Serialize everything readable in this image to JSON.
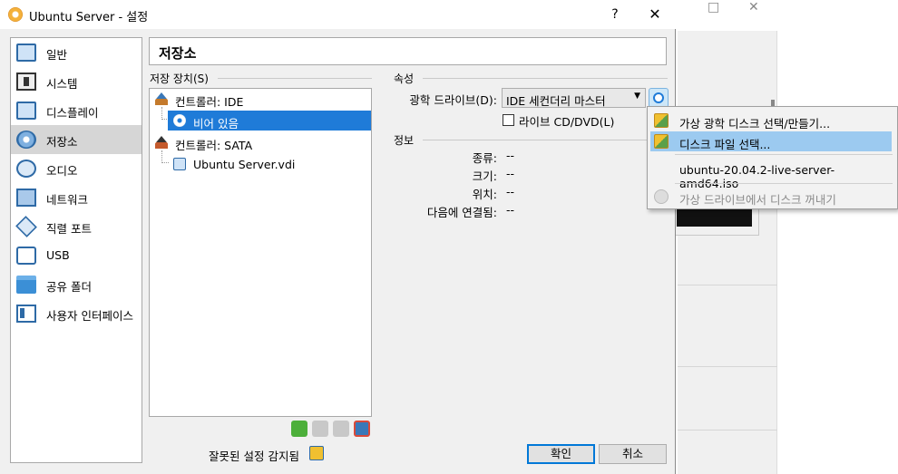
{
  "window": {
    "title": "Ubuntu Server - 설정",
    "help_label": "?",
    "close_label": "✕"
  },
  "sidebar": {
    "items": [
      {
        "label": "일반",
        "icon": "general-icon"
      },
      {
        "label": "시스템",
        "icon": "system-icon"
      },
      {
        "label": "디스플레이",
        "icon": "display-icon"
      },
      {
        "label": "저장소",
        "icon": "storage-icon",
        "selected": true
      },
      {
        "label": "오디오",
        "icon": "audio-icon"
      },
      {
        "label": "네트워크",
        "icon": "network-icon"
      },
      {
        "label": "직렬 포트",
        "icon": "serial-port-icon"
      },
      {
        "label": "USB",
        "icon": "usb-icon"
      },
      {
        "label": "공유 폴더",
        "icon": "shared-folder-icon"
      },
      {
        "label": "사용자 인터페이스",
        "icon": "user-interface-icon"
      }
    ]
  },
  "page": {
    "title": "저장소"
  },
  "storage_devices": {
    "label": "저장 장치(S)",
    "tree": [
      {
        "label": "컨트롤러: IDE",
        "type": "controller"
      },
      {
        "label": "비어 있음",
        "type": "optical",
        "selected": true
      },
      {
        "label": "컨트롤러: SATA",
        "type": "controller"
      },
      {
        "label": "Ubuntu Server.vdi",
        "type": "hard-disk"
      }
    ]
  },
  "attributes": {
    "label": "속성",
    "optical_drive_label": "광학 드라이브(D):",
    "optical_drive_value": "IDE 세컨더리 마스터",
    "live_cd_label": "라이브 CD/DVD(L)"
  },
  "info": {
    "label": "정보",
    "rows": [
      {
        "key": "종류:",
        "value": "--"
      },
      {
        "key": "크기:",
        "value": "--"
      },
      {
        "key": "위치:",
        "value": "--"
      },
      {
        "key": "다음에 연결됨:",
        "value": "--"
      }
    ]
  },
  "footer": {
    "warning_text": "잘못된 설정 감지됨",
    "ok_label": "확인",
    "cancel_label": "취소"
  },
  "popup_menu": {
    "items": [
      {
        "label": "가상 광학 디스크 선택/만들기...",
        "icon": "optical-image-icon"
      },
      {
        "label": "디스크 파일 선택...",
        "icon": "optical-image-icon",
        "highlighted": true
      },
      {
        "label": "ubuntu-20.04.2-live-server-amd64.iso"
      },
      {
        "label": "가상 드라이브에서 디스크 꺼내기",
        "icon": "eject-disk-icon",
        "disabled": true
      }
    ]
  },
  "background_window": {
    "minimize_glyph": "□",
    "close_glyph": "✕"
  }
}
